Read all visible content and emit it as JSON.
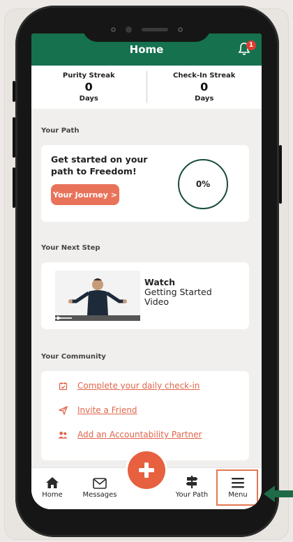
{
  "header": {
    "title": "Home",
    "notification_count": "1"
  },
  "streaks": [
    {
      "label": "Purity Streak",
      "value": "0",
      "unit": "Days"
    },
    {
      "label": "Check-In Streak",
      "value": "0",
      "unit": "Days"
    }
  ],
  "path_section": {
    "title": "Your Path",
    "headline": "Get started on your path to Freedom!",
    "button_label": "Your Journey >",
    "progress_text": "0%"
  },
  "next_step": {
    "title": "Your Next Step",
    "watch_label": "Watch",
    "video_title": "Getting Started Video"
  },
  "community": {
    "title": "Your Community",
    "items": [
      {
        "label": "Complete your daily check-in",
        "icon": "calendar-check-icon"
      },
      {
        "label": "Invite a Friend",
        "icon": "paper-plane-icon"
      },
      {
        "label": "Add an Accountability Partner",
        "icon": "users-icon"
      }
    ]
  },
  "nav": {
    "items": [
      {
        "label": "Home",
        "icon": "home-icon"
      },
      {
        "label": "Messages",
        "icon": "envelope-icon"
      },
      {
        "label": "Your Path",
        "icon": "signpost-icon"
      },
      {
        "label": "Menu",
        "icon": "hamburger-menu-icon"
      }
    ],
    "center_icon": "plus-icon"
  },
  "colors": {
    "brand_green": "#16714f",
    "accent_orange": "#e8735a",
    "fab_orange": "#e7603f",
    "highlight": "#e3774f",
    "pointer_green": "#1f6b48"
  }
}
